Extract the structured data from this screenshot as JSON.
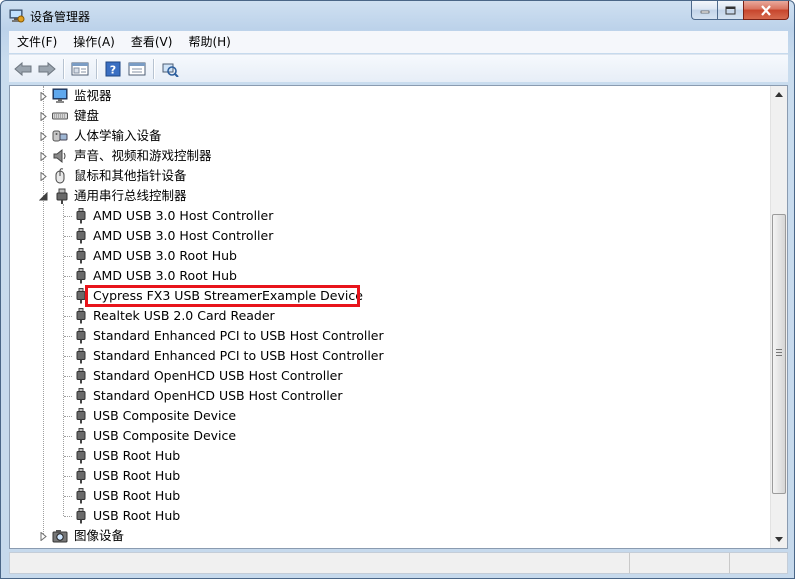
{
  "window": {
    "title": "设备管理器",
    "icons": {
      "app": "device-manager-icon",
      "minimize": "minimize-icon",
      "maximize": "maximize-icon",
      "close": "close-icon"
    }
  },
  "menu": {
    "items": [
      {
        "label": "文件(F)"
      },
      {
        "label": "操作(A)"
      },
      {
        "label": "查看(V)"
      },
      {
        "label": "帮助(H)"
      }
    ]
  },
  "toolbar": {
    "buttons": [
      {
        "icon": "back-arrow-icon"
      },
      {
        "icon": "forward-arrow-icon"
      },
      {
        "icon": "properties-pane-icon"
      },
      {
        "icon": "help-icon"
      },
      {
        "icon": "update-driver-icon"
      },
      {
        "icon": "scan-hardware-icon"
      }
    ]
  },
  "tree": {
    "categories_before": [
      {
        "label": "监视器",
        "icon": "monitor-icon"
      },
      {
        "label": "键盘",
        "icon": "keyboard-icon"
      },
      {
        "label": "人体学输入设备",
        "icon": "hid-icon"
      },
      {
        "label": "声音、视频和游戏控制器",
        "icon": "speaker-icon"
      },
      {
        "label": "鼠标和其他指针设备",
        "icon": "mouse-icon"
      }
    ],
    "usb_category": {
      "label": "通用串行总线控制器",
      "icon": "usb-icon",
      "expanded": true
    },
    "usb_devices": [
      {
        "label": "AMD USB 3.0 Host Controller"
      },
      {
        "label": "AMD USB 3.0 Host Controller"
      },
      {
        "label": "AMD USB 3.0 Root Hub"
      },
      {
        "label": "AMD USB 3.0 Root Hub"
      },
      {
        "label": "Cypress FX3 USB StreamerExample Device",
        "highlighted": true
      },
      {
        "label": "Realtek USB 2.0 Card Reader"
      },
      {
        "label": "Standard Enhanced PCI to USB Host Controller"
      },
      {
        "label": "Standard Enhanced PCI to USB Host Controller"
      },
      {
        "label": "Standard OpenHCD USB Host Controller"
      },
      {
        "label": "Standard OpenHCD USB Host Controller"
      },
      {
        "label": "USB Composite Device"
      },
      {
        "label": "USB Composite Device"
      },
      {
        "label": "USB Root Hub"
      },
      {
        "label": "USB Root Hub"
      },
      {
        "label": "USB Root Hub"
      },
      {
        "label": "USB Root Hub"
      }
    ],
    "categories_after": [
      {
        "label": "图像设备",
        "icon": "camera-icon"
      }
    ]
  },
  "colors": {
    "highlight_border": "#e8141b",
    "window_frame": "#bcd2ea"
  }
}
